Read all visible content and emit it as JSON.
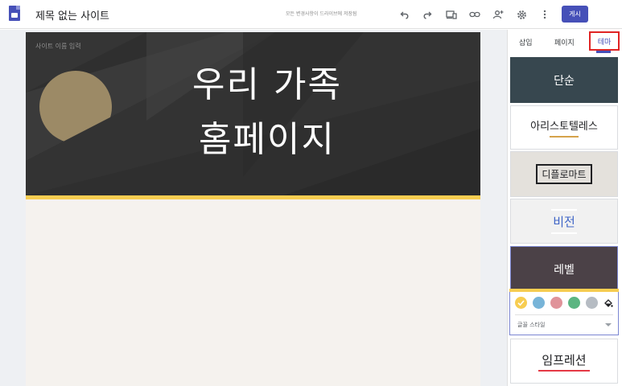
{
  "app": {
    "site_title": "제목 없는 사이트",
    "save_status": "모든 변경사항이 드라이브에 저장됨",
    "publish_label": "게시"
  },
  "toolbar": {
    "icons": [
      "undo-icon",
      "redo-icon",
      "preview-device-icon",
      "link-icon",
      "share-user-icon",
      "gear-icon",
      "more-vert-icon"
    ]
  },
  "canvas": {
    "site_name_placeholder": "사이트 이름 입력",
    "hero_line1": "우리 가족",
    "hero_line2": "홈페이지"
  },
  "panel": {
    "tabs": [
      {
        "label": "삽입"
      },
      {
        "label": "페이지"
      },
      {
        "label": "테마",
        "selected": true
      }
    ],
    "themes": [
      {
        "name": "단순",
        "bg": "#37474f",
        "fg": "#ffffff"
      },
      {
        "name": "아리스토텔레스",
        "bg": "#ffffff",
        "fg": "#202124",
        "accent": "#d5a24a"
      },
      {
        "name": "디플로마트",
        "bg": "#e4e1dc",
        "fg": "#202124"
      },
      {
        "name": "비전",
        "bg": "#f1f1f1",
        "fg": "#3f65c7"
      },
      {
        "name": "레벨",
        "bg": "#4b4147",
        "fg": "#ffffff",
        "selected": true
      },
      {
        "name": "임프레션",
        "bg": "#ffffff",
        "fg": "#202124",
        "accent": "#e53945"
      }
    ],
    "color_swatches": [
      "#f7cd51",
      "#77b4d8",
      "#e0939a",
      "#5bb581",
      "#b6bcc3"
    ],
    "font_style_label": "글꼴 스타일"
  },
  "colors": {
    "brand": "#4650b8",
    "highlight_border": "#e02424",
    "header_accent": "#f7cd51"
  }
}
